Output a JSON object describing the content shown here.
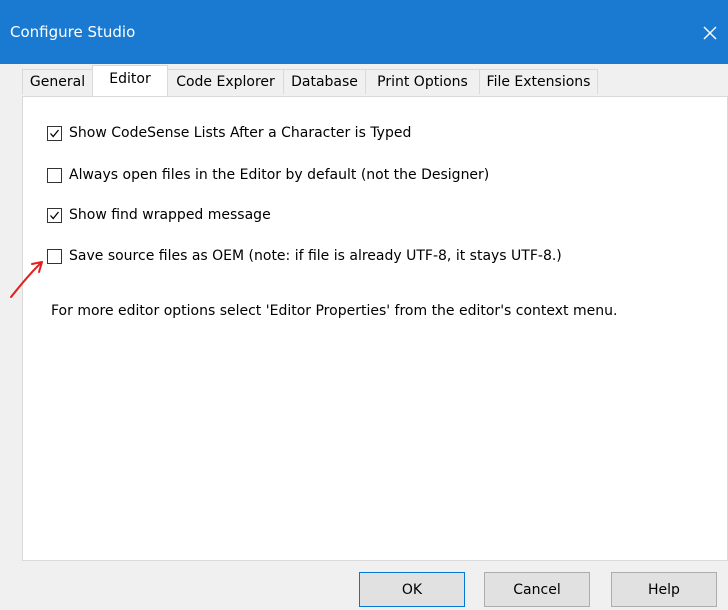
{
  "window": {
    "title": "Configure Studio"
  },
  "tabs": [
    {
      "label": "General"
    },
    {
      "label": "Editor"
    },
    {
      "label": "Code Explorer"
    },
    {
      "label": "Database"
    },
    {
      "label": "Print Options"
    },
    {
      "label": "File Extensions"
    }
  ],
  "active_tab": "Editor",
  "options": [
    {
      "label": "Show CodeSense Lists After a Character is Typed",
      "checked": true
    },
    {
      "label": "Always open files in the Editor by default (not the Designer)",
      "checked": false
    },
    {
      "label": "Show find wrapped message",
      "checked": true
    },
    {
      "label": "Save source files as OEM (note: if file is already UTF-8, it stays UTF-8.)",
      "checked": false
    }
  ],
  "info_text": "For more editor options select 'Editor Properties' from the editor's context menu.",
  "buttons": {
    "ok": "OK",
    "cancel": "Cancel",
    "help": "Help"
  },
  "icons": {
    "close": "close-icon",
    "checkmark": "checkmark-icon",
    "annotation": "red-arrow-icon"
  },
  "colors": {
    "titlebar": "#1a7ad2",
    "annotation": "#e02020"
  }
}
